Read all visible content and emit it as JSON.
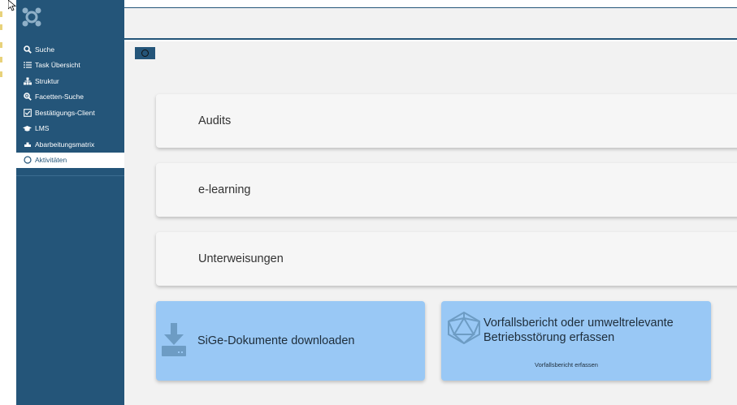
{
  "sidebar": {
    "logo_icon": "app-logo-icon",
    "items": [
      {
        "label": "Suche",
        "icon": "search-icon",
        "active": false
      },
      {
        "label": "Task Übersicht",
        "icon": "task-list-icon",
        "active": false
      },
      {
        "label": "Struktur",
        "icon": "sitemap-icon",
        "active": false
      },
      {
        "label": "Facetten-Suche",
        "icon": "search-plus-icon",
        "active": false
      },
      {
        "label": "Bestätigungs-Client",
        "icon": "check-square-icon",
        "active": false
      },
      {
        "label": "LMS",
        "icon": "graduation-cap-icon",
        "active": false
      },
      {
        "label": "Abarbeitungsmatrix",
        "icon": "matrix-icon",
        "active": false
      },
      {
        "label": "Aktivitäten",
        "icon": "circle-icon",
        "active": true
      }
    ]
  },
  "main": {
    "toggle_icon": "circle-toggle-icon",
    "cards": [
      {
        "label": "Audits"
      },
      {
        "label": "e-learning"
      },
      {
        "label": "Unterweisungen"
      }
    ],
    "tiles": [
      {
        "title": "SiGe-Dokumente downloaden",
        "icon": "download-icon",
        "subtitle": ""
      },
      {
        "title_line1": "Vorfallsbericht oder umweltrelevante",
        "title_line2": "Betriebsstörung erfassen",
        "subtitle": "Vorfallsbericht erfassen",
        "icon": "polyhedron-icon"
      }
    ]
  },
  "colors": {
    "sidebar_bg": "#245579",
    "main_bg": "#f2f2f2",
    "tile_bg": "#99c8f5",
    "card_bg": "#f6f6f6"
  }
}
